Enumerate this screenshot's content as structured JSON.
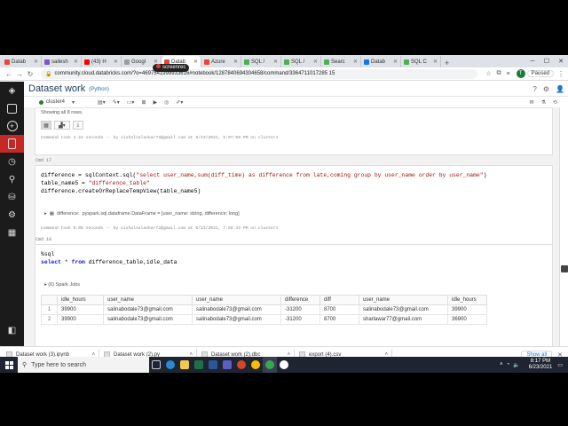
{
  "browser": {
    "tabs": [
      {
        "label": "Datab",
        "color": "#e8453c"
      },
      {
        "label": "sailesh",
        "color": "#7e57c2"
      },
      {
        "label": "(43) H",
        "color": "#ff0000"
      },
      {
        "label": "Googl",
        "color": "#9e9e9e"
      },
      {
        "label": "Datab",
        "color": "#e8453c",
        "active": true
      },
      {
        "label": "Azure",
        "color": "#e8453c"
      },
      {
        "label": "SQL /",
        "color": "#4caf50"
      },
      {
        "label": "SQL /",
        "color": "#4caf50"
      },
      {
        "label": "Searc",
        "color": "#4caf50"
      },
      {
        "label": "Datab",
        "color": "#1a73e8"
      },
      {
        "label": "SQL C",
        "color": "#4caf50"
      }
    ],
    "url": "community.cloud.databricks.com/?o=4697541999933616#notebook/1287840694304658/command/3364711017285 15",
    "recorder_badge": "screenrec",
    "profile_initial": "T",
    "profile_status": "Paused"
  },
  "notebook": {
    "title": "Dataset work",
    "language": "(Python)",
    "cluster": "cluster4"
  },
  "cells": {
    "prev": {
      "rows_note": "Showing all 8 rows.",
      "meta": "Command took 2.24 seconds -- by vishalsalaskar72@gmail.com at 6/23/2021, 5:07:59 PM on cluster4"
    },
    "cmd17": {
      "label": "Cmd 17",
      "line1_a": "difference = sqlContext.sql(",
      "line1_s": "\"select user_name,sum(diff_time) as difference from late,coming group by user_name order by user_name\"",
      "line1_b": ")",
      "line2_a": "table_name5 = ",
      "line2_s": "\"difference_table\"",
      "line3": "difference.createOrReplaceTempView(table_name5)",
      "df_var": "difference:",
      "df_type": "pyspark.sql.dataframe.DataFrame = [user_name: string, difference: long]",
      "meta": "Command took 0.06 seconds -- by vishalsalaskar72@gmail.com at 6/23/2021, 7:58:43 PM on cluster4"
    },
    "cmd18": {
      "label": "Cmd 18",
      "magic": "%sql",
      "kw1": "select",
      "op": " * ",
      "kw2": "from",
      "rest": " difference_table,idle_data",
      "jobs": "(6) Spark Jobs",
      "headers": [
        "idle_hours",
        "user_name",
        "user_name",
        "difference",
        "diff",
        "user_name",
        "idle_hours"
      ],
      "rows": [
        [
          "1",
          "39900",
          "salinabodale73@gmail.com",
          "salinabodale73@gmail.com",
          "-31200",
          "8700",
          "salinabodale73@gmail.com",
          "39900"
        ],
        [
          "2",
          "39900",
          "salinabodale73@gmail.com",
          "salinabodale73@gmail.com",
          "-31200",
          "8700",
          "sharlawar77@gmail.com",
          "36900"
        ]
      ]
    }
  },
  "downloads": {
    "items": [
      "Dataset work (3).ipynb",
      "Dataset work (2).py",
      "Dataset work (2).dbc",
      "export (4).csv"
    ],
    "show_all": "Show all"
  },
  "taskbar": {
    "search_placeholder": "Type here to search",
    "time": "8:17 PM",
    "date": "6/23/2021"
  }
}
